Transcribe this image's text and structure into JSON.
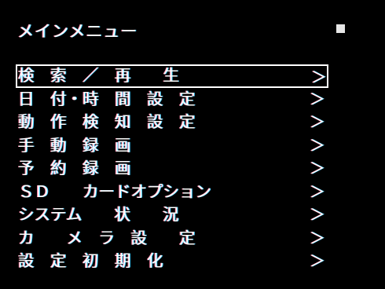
{
  "header": {
    "title": "メインメニュー"
  },
  "menu": {
    "selected_index": 0,
    "items": [
      {
        "label": "検　索　／　再　　生",
        "arrow": "＞"
      },
      {
        "label": "日　付・時　間　設　定",
        "arrow": "＞"
      },
      {
        "label": "動　作　検　知　設　定",
        "arrow": "＞"
      },
      {
        "label": "手　動　録　画",
        "arrow": "＞"
      },
      {
        "label": "予　約　録　画",
        "arrow": "＞"
      },
      {
        "label": "ＳＤ　　カードオプション",
        "arrow": "＞"
      },
      {
        "label": "システム　　状　　況",
        "arrow": "＞"
      },
      {
        "label": "カ　　メ　ラ　設　　定",
        "arrow": "＞"
      },
      {
        "label": "設　定　初　期　化",
        "arrow": "＞"
      }
    ]
  },
  "colors": {
    "background": "#000000",
    "text": "#ffffff",
    "selection_border": "#ffffff",
    "indicator": "#e6e6e6"
  },
  "icons": {
    "indicator": "square-indicator-icon",
    "arrow": "chevron-right-icon"
  }
}
